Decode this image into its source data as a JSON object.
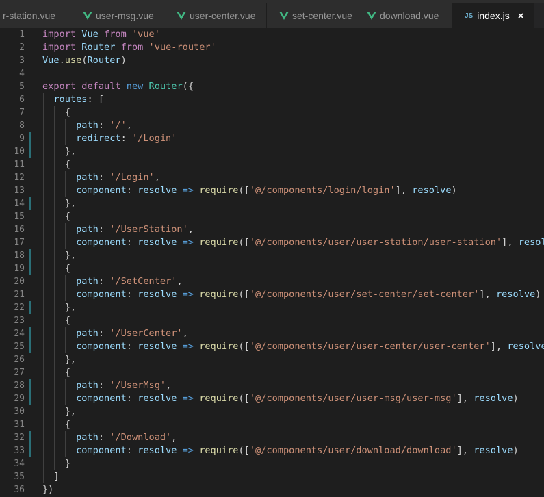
{
  "tabs": [
    {
      "label": "r-station.vue",
      "type": "vue",
      "active": false
    },
    {
      "label": "user-msg.vue",
      "type": "vue",
      "active": false
    },
    {
      "label": "user-center.vue",
      "type": "vue",
      "active": false
    },
    {
      "label": "set-center.vue",
      "type": "vue",
      "active": false
    },
    {
      "label": "download.vue",
      "type": "vue",
      "active": false
    },
    {
      "label": "index.js",
      "type": "js",
      "active": true,
      "icon_text": "JS",
      "close_glyph": "×"
    }
  ],
  "colors": {
    "keyword": "#569cd6",
    "control": "#c586c0",
    "identifier": "#9cdcfe",
    "class": "#4ec9b0",
    "function": "#dcdcaa",
    "string": "#ce9178",
    "punctuation": "#d4d4d4",
    "vue_green": "#41b883",
    "gutter_modified": "#2b6f77"
  },
  "lines": [
    {
      "n": "1",
      "tokens": [
        [
          "import",
          "ctl"
        ],
        [
          " Vue ",
          "id"
        ],
        [
          "from",
          "ctl"
        ],
        [
          " ",
          "pn"
        ],
        [
          "'vue'",
          "str"
        ]
      ]
    },
    {
      "n": "2",
      "tokens": [
        [
          "import",
          "ctl"
        ],
        [
          " Router ",
          "id"
        ],
        [
          "from",
          "ctl"
        ],
        [
          " ",
          "pn"
        ],
        [
          "'vue-router'",
          "str"
        ]
      ]
    },
    {
      "n": "3",
      "tokens": [
        [
          "Vue",
          "id"
        ],
        [
          ".",
          "pn"
        ],
        [
          "use",
          "fn"
        ],
        [
          "(",
          "pn"
        ],
        [
          "Router",
          "id"
        ],
        [
          ")",
          "pn"
        ]
      ]
    },
    {
      "n": "4",
      "tokens": []
    },
    {
      "n": "5",
      "tokens": [
        [
          "export",
          "ctl"
        ],
        [
          " ",
          "pn"
        ],
        [
          "default",
          "ctl"
        ],
        [
          " ",
          "pn"
        ],
        [
          "new",
          "kw"
        ],
        [
          " ",
          "pn"
        ],
        [
          "Router",
          "cls"
        ],
        [
          "({",
          "pn"
        ]
      ]
    },
    {
      "n": "6",
      "tokens": [
        [
          "  routes",
          "id"
        ],
        [
          ": [",
          "pn"
        ]
      ]
    },
    {
      "n": "7",
      "tokens": [
        [
          "    {",
          "pn"
        ]
      ]
    },
    {
      "n": "8",
      "tokens": [
        [
          "      path",
          "id"
        ],
        [
          ": ",
          "pn"
        ],
        [
          "'/'",
          "str"
        ],
        [
          ",",
          "pn"
        ]
      ]
    },
    {
      "n": "9",
      "tokens": [
        [
          "      redirect",
          "id"
        ],
        [
          ": ",
          "pn"
        ],
        [
          "'/Login'",
          "str"
        ]
      ],
      "mark": true
    },
    {
      "n": "10",
      "tokens": [
        [
          "    },",
          "pn"
        ]
      ],
      "mark": true
    },
    {
      "n": "11",
      "tokens": [
        [
          "    {",
          "pn"
        ]
      ]
    },
    {
      "n": "12",
      "tokens": [
        [
          "      path",
          "id"
        ],
        [
          ": ",
          "pn"
        ],
        [
          "'/Login'",
          "str"
        ],
        [
          ",",
          "pn"
        ]
      ]
    },
    {
      "n": "13",
      "tokens": [
        [
          "      component",
          "id"
        ],
        [
          ": ",
          "pn"
        ],
        [
          "resolve",
          "id"
        ],
        [
          " ",
          "pn"
        ],
        [
          "=>",
          "kw"
        ],
        [
          " ",
          "pn"
        ],
        [
          "require",
          "fn"
        ],
        [
          "([",
          "pn"
        ],
        [
          "'@/components/login/login'",
          "str"
        ],
        [
          "], ",
          "pn"
        ],
        [
          "resolve",
          "id"
        ],
        [
          ")",
          "pn"
        ]
      ]
    },
    {
      "n": "14",
      "tokens": [
        [
          "    },",
          "pn"
        ]
      ],
      "mark": true
    },
    {
      "n": "15",
      "tokens": [
        [
          "    {",
          "pn"
        ]
      ]
    },
    {
      "n": "16",
      "tokens": [
        [
          "      path",
          "id"
        ],
        [
          ": ",
          "pn"
        ],
        [
          "'/UserStation'",
          "str"
        ],
        [
          ",",
          "pn"
        ]
      ]
    },
    {
      "n": "17",
      "tokens": [
        [
          "      component",
          "id"
        ],
        [
          ": ",
          "pn"
        ],
        [
          "resolve",
          "id"
        ],
        [
          " ",
          "pn"
        ],
        [
          "=>",
          "kw"
        ],
        [
          " ",
          "pn"
        ],
        [
          "require",
          "fn"
        ],
        [
          "([",
          "pn"
        ],
        [
          "'@/components/user/user-station/user-station'",
          "str"
        ],
        [
          "], ",
          "pn"
        ],
        [
          "resolve",
          "id"
        ],
        [
          ")",
          "pn"
        ]
      ]
    },
    {
      "n": "18",
      "tokens": [
        [
          "    },",
          "pn"
        ]
      ],
      "mark": true
    },
    {
      "n": "19",
      "tokens": [
        [
          "    {",
          "pn"
        ]
      ],
      "mark": true
    },
    {
      "n": "20",
      "tokens": [
        [
          "      path",
          "id"
        ],
        [
          ": ",
          "pn"
        ],
        [
          "'/SetCenter'",
          "str"
        ],
        [
          ",",
          "pn"
        ]
      ]
    },
    {
      "n": "21",
      "tokens": [
        [
          "      component",
          "id"
        ],
        [
          ": ",
          "pn"
        ],
        [
          "resolve",
          "id"
        ],
        [
          " ",
          "pn"
        ],
        [
          "=>",
          "kw"
        ],
        [
          " ",
          "pn"
        ],
        [
          "require",
          "fn"
        ],
        [
          "([",
          "pn"
        ],
        [
          "'@/components/user/set-center/set-center'",
          "str"
        ],
        [
          "], ",
          "pn"
        ],
        [
          "resolve",
          "id"
        ],
        [
          ")",
          "pn"
        ]
      ]
    },
    {
      "n": "22",
      "tokens": [
        [
          "    },",
          "pn"
        ]
      ],
      "mark": true
    },
    {
      "n": "23",
      "tokens": [
        [
          "    {",
          "pn"
        ]
      ]
    },
    {
      "n": "24",
      "tokens": [
        [
          "      path",
          "id"
        ],
        [
          ": ",
          "pn"
        ],
        [
          "'/UserCenter'",
          "str"
        ],
        [
          ",",
          "pn"
        ]
      ],
      "mark": true
    },
    {
      "n": "25",
      "tokens": [
        [
          "      component",
          "id"
        ],
        [
          ": ",
          "pn"
        ],
        [
          "resolve",
          "id"
        ],
        [
          " ",
          "pn"
        ],
        [
          "=>",
          "kw"
        ],
        [
          " ",
          "pn"
        ],
        [
          "require",
          "fn"
        ],
        [
          "([",
          "pn"
        ],
        [
          "'@/components/user/user-center/user-center'",
          "str"
        ],
        [
          "], ",
          "pn"
        ],
        [
          "resolve",
          "id"
        ],
        [
          ")",
          "pn"
        ]
      ],
      "mark": true
    },
    {
      "n": "26",
      "tokens": [
        [
          "    },",
          "pn"
        ]
      ]
    },
    {
      "n": "27",
      "tokens": [
        [
          "    {",
          "pn"
        ]
      ]
    },
    {
      "n": "28",
      "tokens": [
        [
          "      path",
          "id"
        ],
        [
          ": ",
          "pn"
        ],
        [
          "'/UserMsg'",
          "str"
        ],
        [
          ",",
          "pn"
        ]
      ],
      "mark": true
    },
    {
      "n": "29",
      "tokens": [
        [
          "      component",
          "id"
        ],
        [
          ": ",
          "pn"
        ],
        [
          "resolve",
          "id"
        ],
        [
          " ",
          "pn"
        ],
        [
          "=>",
          "kw"
        ],
        [
          " ",
          "pn"
        ],
        [
          "require",
          "fn"
        ],
        [
          "([",
          "pn"
        ],
        [
          "'@/components/user/user-msg/user-msg'",
          "str"
        ],
        [
          "], ",
          "pn"
        ],
        [
          "resolve",
          "id"
        ],
        [
          ")",
          "pn"
        ]
      ],
      "mark": true
    },
    {
      "n": "30",
      "tokens": [
        [
          "    },",
          "pn"
        ]
      ]
    },
    {
      "n": "31",
      "tokens": [
        [
          "    {",
          "pn"
        ]
      ]
    },
    {
      "n": "32",
      "tokens": [
        [
          "      path",
          "id"
        ],
        [
          ": ",
          "pn"
        ],
        [
          "'/Download'",
          "str"
        ],
        [
          ",",
          "pn"
        ]
      ],
      "mark": true
    },
    {
      "n": "33",
      "tokens": [
        [
          "      component",
          "id"
        ],
        [
          ": ",
          "pn"
        ],
        [
          "resolve",
          "id"
        ],
        [
          " ",
          "pn"
        ],
        [
          "=>",
          "kw"
        ],
        [
          " ",
          "pn"
        ],
        [
          "require",
          "fn"
        ],
        [
          "([",
          "pn"
        ],
        [
          "'@/components/user/download/download'",
          "str"
        ],
        [
          "], ",
          "pn"
        ],
        [
          "resolve",
          "id"
        ],
        [
          ")",
          "pn"
        ]
      ],
      "mark": true
    },
    {
      "n": "34",
      "tokens": [
        [
          "    }",
          "pn"
        ]
      ]
    },
    {
      "n": "35",
      "tokens": [
        [
          "  ]",
          "pn"
        ]
      ]
    },
    {
      "n": "36",
      "tokens": [
        [
          "})",
          "pn"
        ]
      ]
    }
  ]
}
